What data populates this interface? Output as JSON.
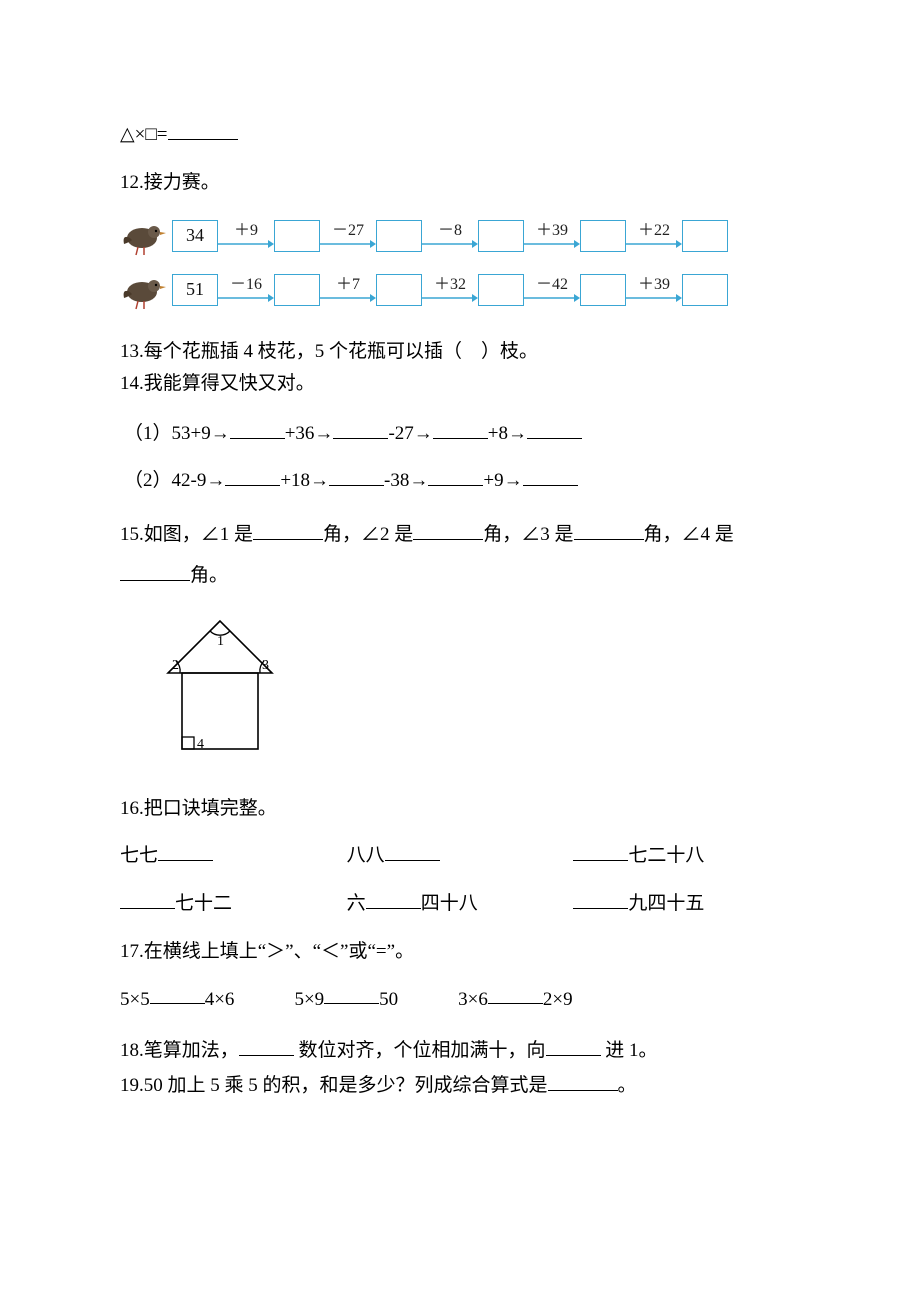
{
  "q_top": {
    "expr": "△×□="
  },
  "q12": {
    "title": "12.接力赛。",
    "row1": {
      "start": "34",
      "ops": [
        "＋9",
        "－27",
        "－8",
        "＋39",
        "＋22"
      ]
    },
    "row2": {
      "start": "51",
      "ops": [
        "－16",
        "＋7",
        "＋32",
        "－42",
        "＋39"
      ]
    }
  },
  "q13": {
    "text_a": "13.每个花瓶插 4 枝花，5 个花瓶可以插（",
    "text_b": "）枝。"
  },
  "q14": {
    "title": "14.我能算得又快又对。",
    "line1": {
      "lead": "（1）53+9→",
      "segs": [
        "+36→",
        "-27→",
        "+8→"
      ]
    },
    "line2": {
      "lead": "（2）42-9→",
      "segs": [
        "+18→",
        "-38→",
        "+9→"
      ]
    }
  },
  "q15": {
    "a": "15.如图，∠1 是",
    "b": "角，∠2 是",
    "c": "角，∠3 是",
    "d": "角，∠4 是",
    "e": "角。",
    "labels": {
      "a1": "1",
      "a2": "2",
      "a3": "3",
      "a4": "4"
    }
  },
  "q16": {
    "title": "16.把口诀填完整。",
    "r1": {
      "a": "七七",
      "b": "八八",
      "c": "七二十八"
    },
    "r2": {
      "a": "七十二",
      "b1": "六",
      "b2": "四十八",
      "c": "九四十五"
    }
  },
  "q17": {
    "title": "17.在横线上填上“＞”、“＜”或“=”。",
    "items": [
      {
        "l": "5×5",
        "r": "4×6"
      },
      {
        "l": "5×9",
        "r": "50"
      },
      {
        "l": "3×6",
        "r": "2×9"
      }
    ]
  },
  "q18": {
    "a": "18.笔算加法，",
    "b": " 数位对齐，个位相加满十，向",
    "c": " 进 1。"
  },
  "q19": {
    "a": "19.50 加上 5 乘 5 的积，和是多少？列成综合算式是",
    "b": "。"
  }
}
